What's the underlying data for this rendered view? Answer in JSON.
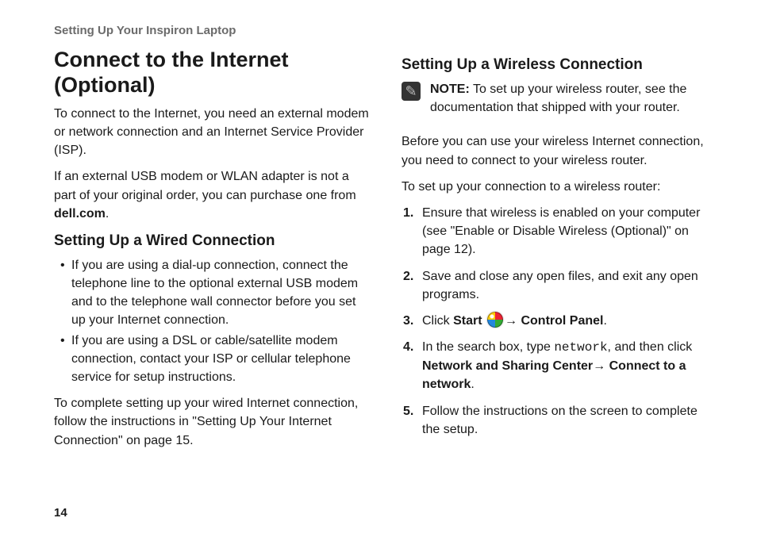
{
  "header": "Setting Up Your Inspiron Laptop",
  "page_number": "14",
  "left": {
    "title": "Connect to the Internet (Optional)",
    "intro1": "To connect to the Internet, you need an external modem or network connection and an Internet Service Provider (ISP).",
    "intro2_pre": "If an external USB modem or WLAN adapter is not a part of your original order, you can purchase one from ",
    "intro2_bold": "dell.com",
    "intro2_post": ".",
    "wired_heading": "Setting Up a Wired Connection",
    "bullet1": "If you are using a dial-up connection, connect the telephone line to the optional external USB modem and to the telephone wall connector before you set up your Internet connection.",
    "bullet2": "If you are using a DSL or cable/satellite modem connection, contact your ISP or cellular telephone service for setup instructions.",
    "wired_outro": "To complete setting up your wired Internet connection, follow the instructions in \"Setting Up Your Internet Connection\" on page 15."
  },
  "right": {
    "wireless_heading": "Setting Up a Wireless Connection",
    "note_label": "NOTE:",
    "note_text": " To set up your wireless router, see the documentation that shipped with your router.",
    "p1": "Before you can use your wireless Internet connection, you need to connect to your wireless router.",
    "p2": "To set up your connection to a wireless router:",
    "step1": "Ensure that wireless is enabled on your computer (see \"Enable or Disable Wireless (Optional)\" on page 12).",
    "step2": "Save and close any open files, and exit any open programs.",
    "step3_click": "Click ",
    "step3_start": "Start ",
    "step3_arrow": "→ ",
    "step3_cp": "Control Panel",
    "step3_end": ".",
    "step4_pre": "In the search box, type ",
    "step4_code": "network",
    "step4_mid": ", and then click ",
    "step4_b1": "Network and Sharing Center",
    "step4_arrow": "→ ",
    "step4_b2": "Connect to a network",
    "step4_end": ".",
    "step5": "Follow the instructions on the screen to complete the setup.",
    "nums": {
      "n1": "1.",
      "n2": "2.",
      "n3": "3.",
      "n4": "4.",
      "n5": "5."
    }
  }
}
